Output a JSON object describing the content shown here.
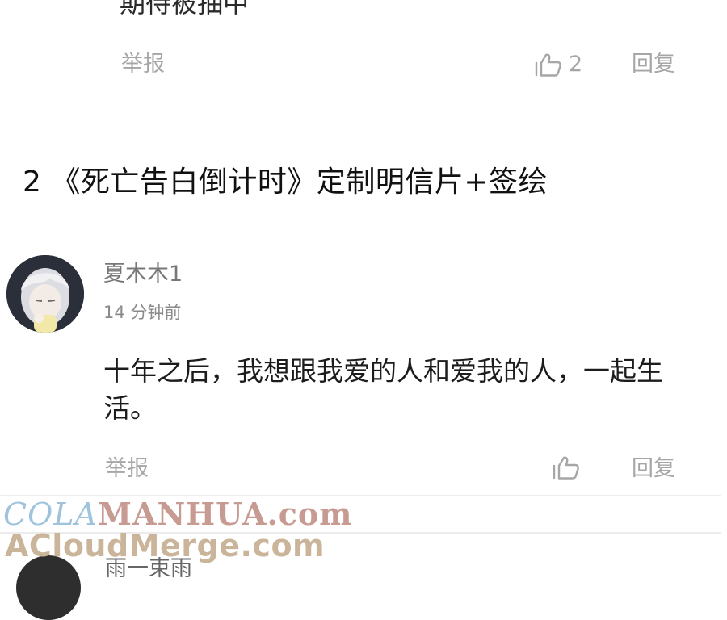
{
  "previous_comment": {
    "text": "期待被抽中",
    "report_label": "举报",
    "like_count": "2",
    "reply_label": "回复"
  },
  "section": {
    "title": "2 《死亡告白倒计时》定制明信片+签绘"
  },
  "comment": {
    "username": "夏木木1",
    "time": "14 分钟前",
    "text": "十年之后，我想跟我爱的人和爱我的人，一起生活。",
    "report_label": "举报",
    "reply_label": "回复"
  },
  "next_comment": {
    "username": "雨一束雨"
  },
  "watermark": {
    "line1_a": "COLA",
    "line1_b": "MANHUA.com",
    "line2": "ACloudMerge.com"
  },
  "colors": {
    "action_gray": "#a6a6a6",
    "watermark_blue": "#9fc3dc",
    "watermark_rose": "#c79a92",
    "watermark_tan": "#cbb59a"
  }
}
